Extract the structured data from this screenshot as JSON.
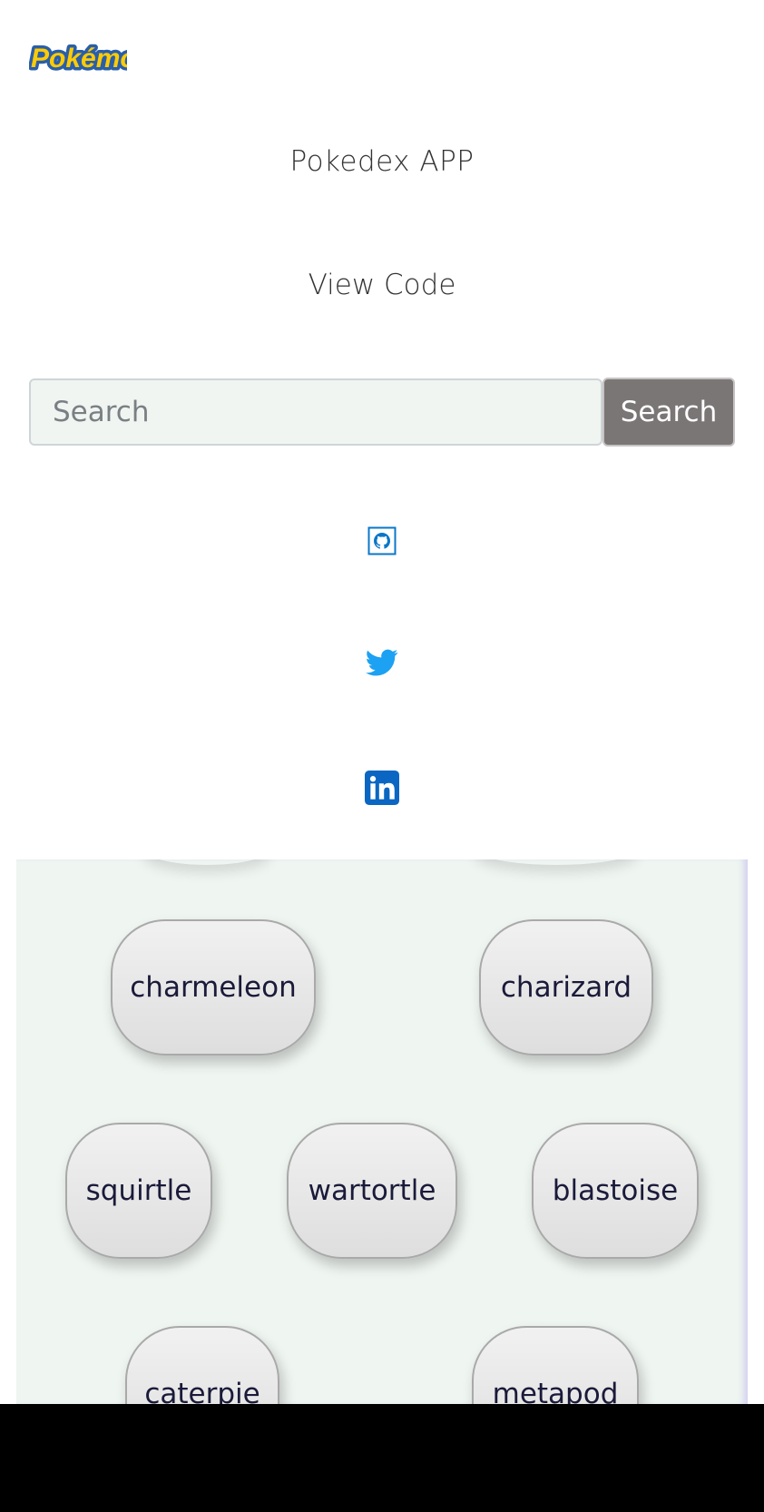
{
  "header": {
    "logo_text": "Pokémon",
    "title": "Pokedex APP",
    "view_code": "View Code"
  },
  "search": {
    "placeholder": "Search",
    "button_label": "Search"
  },
  "social": {
    "github": "github-icon",
    "twitter": "twitter-icon",
    "linkedin": "linkedin-icon"
  },
  "pokemon": [
    "charmeleon",
    "charizard",
    "squirtle",
    "wartortle",
    "blastoise",
    "caterpie",
    "metapod"
  ],
  "colors": {
    "search_button": "#7a7676",
    "list_background": "#eff5f1",
    "twitter": "#1da1f2",
    "linkedin": "#0a66c2",
    "github": "#0a77c9"
  }
}
